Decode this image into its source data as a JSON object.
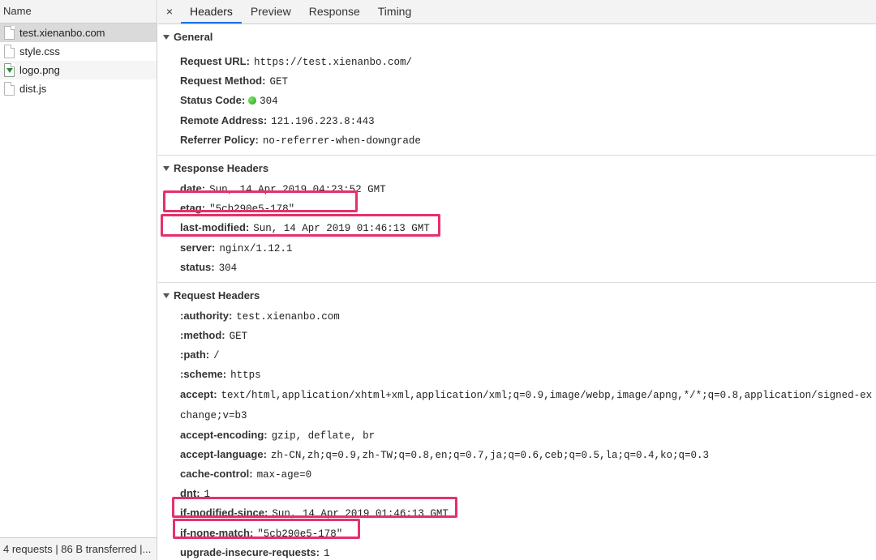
{
  "requests_panel": {
    "header": "Name",
    "items": [
      {
        "name": "test.xienanbo.com",
        "icon": "document-icon"
      },
      {
        "name": "style.css",
        "icon": "document-icon"
      },
      {
        "name": "logo.png",
        "icon": "image-icon"
      },
      {
        "name": "dist.js",
        "icon": "document-icon"
      }
    ],
    "footer": "4 requests | 86 B transferred |..."
  },
  "tabs": {
    "close": "×",
    "items": [
      "Headers",
      "Preview",
      "Response",
      "Timing"
    ],
    "active": "Headers"
  },
  "general": {
    "title": "General",
    "rows": [
      {
        "key": "Request URL:",
        "value": "https://test.xienanbo.com/"
      },
      {
        "key": "Request Method:",
        "value": "GET"
      },
      {
        "key": "Status Code:",
        "value": "304",
        "status_color": "#22b022"
      },
      {
        "key": "Remote Address:",
        "value": "121.196.223.8:443"
      },
      {
        "key": "Referrer Policy:",
        "value": "no-referrer-when-downgrade"
      }
    ]
  },
  "response_headers": {
    "title": "Response Headers",
    "rows": [
      {
        "key": "date:",
        "value": "Sun, 14 Apr 2019 04:23:52 GMT"
      },
      {
        "key": "etag:",
        "value": "\"5cb290e5-178\""
      },
      {
        "key": "last-modified:",
        "value": "Sun, 14 Apr 2019 01:46:13 GMT"
      },
      {
        "key": "server:",
        "value": "nginx/1.12.1"
      },
      {
        "key": "status:",
        "value": "304"
      }
    ]
  },
  "request_headers": {
    "title": "Request Headers",
    "rows": [
      {
        "key": ":authority:",
        "value": "test.xienanbo.com"
      },
      {
        "key": ":method:",
        "value": "GET"
      },
      {
        "key": ":path:",
        "value": "/"
      },
      {
        "key": ":scheme:",
        "value": "https"
      },
      {
        "key": "accept:",
        "value": "text/html,application/xhtml+xml,application/xml;q=0.9,image/webp,image/apng,*/*;q=0.8,application/signed-exchange;v=b3"
      },
      {
        "key": "accept-encoding:",
        "value": "gzip, deflate, br"
      },
      {
        "key": "accept-language:",
        "value": "zh-CN,zh;q=0.9,zh-TW;q=0.8,en;q=0.7,ja;q=0.6,ceb;q=0.5,la;q=0.4,ko;q=0.3"
      },
      {
        "key": "cache-control:",
        "value": "max-age=0"
      },
      {
        "key": "dnt:",
        "value": "1"
      },
      {
        "key": "if-modified-since:",
        "value": "Sun, 14 Apr 2019 01:46:13 GMT"
      },
      {
        "key": "if-none-match:",
        "value": "\"5cb290e5-178\""
      },
      {
        "key": "upgrade-insecure-requests:",
        "value": "1"
      }
    ]
  },
  "colors": {
    "highlight": "#e5316b",
    "active_tab": "#1a73e8",
    "status_ok": "#22b022"
  }
}
